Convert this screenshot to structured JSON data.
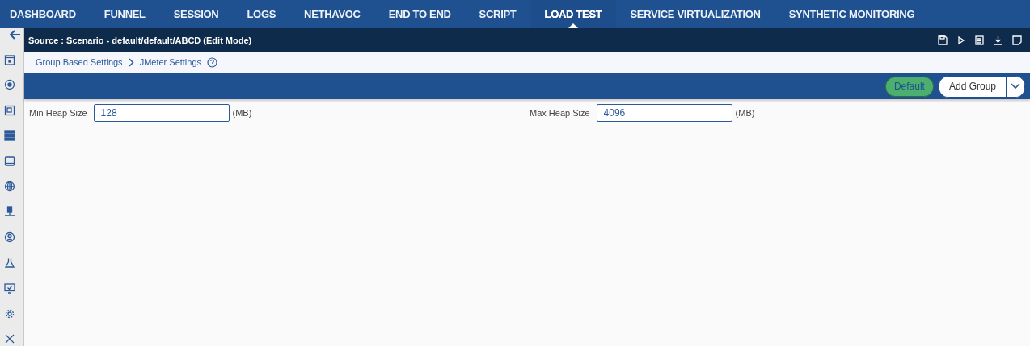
{
  "nav_tabs": [
    {
      "label": "DASHBOARD",
      "selected": false
    },
    {
      "label": "FUNNEL",
      "selected": false
    },
    {
      "label": "SESSION",
      "selected": false
    },
    {
      "label": "LOGS",
      "selected": false
    },
    {
      "label": "NETHAVOC",
      "selected": false
    },
    {
      "label": "END TO END",
      "selected": false
    },
    {
      "label": "SCRIPT",
      "selected": false
    },
    {
      "label": "LOAD TEST",
      "selected": true
    },
    {
      "label": "SERVICE VIRTUALIZATION",
      "selected": false
    },
    {
      "label": "SYNTHETIC MONITORING",
      "selected": false
    }
  ],
  "source_bar": {
    "title": "Source : Scenario - default/default/ABCD (Edit Mode)"
  },
  "breadcrumb": [
    "Group Based Settings",
    "JMeter Settings"
  ],
  "toolbar": {
    "buttons": [
      "Default",
      "Add Group"
    ]
  },
  "fields": [
    {
      "label": "Min Heap Size",
      "value": "128",
      "unit": "(MB)"
    },
    {
      "label": "Max Heap Size",
      "value": "4096",
      "unit": "(MB)"
    }
  ]
}
